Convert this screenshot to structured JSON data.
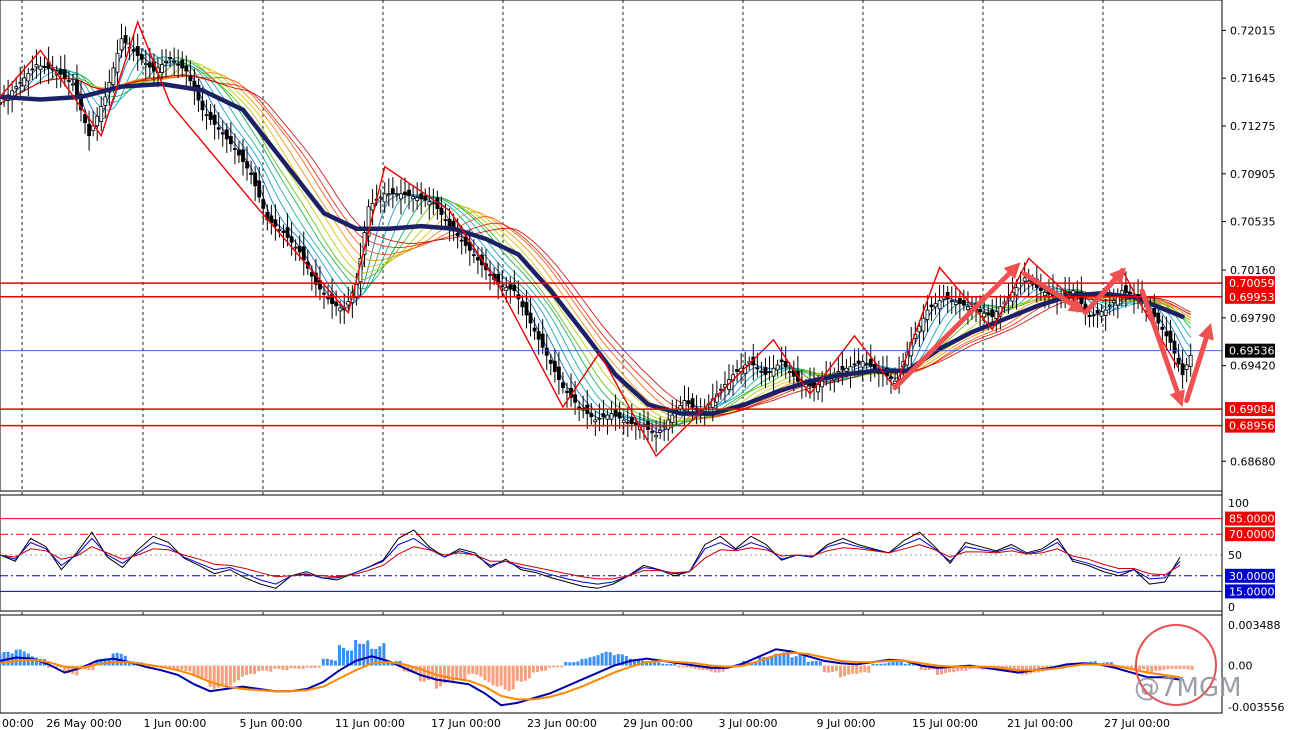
{
  "chart_data": [
    {
      "panel": "price",
      "type": "candlestick",
      "y_ticks": [
        "0.72015",
        "0.71645",
        "0.71275",
        "0.70905",
        "0.70535",
        "0.70160",
        "0.69790",
        "0.69420",
        "0.68680"
      ],
      "ylim": [
        0.6845,
        0.7225
      ],
      "x_tick_labels": [
        "00:00",
        "26 May 00:00",
        "1 Jun 00:00",
        "5 Jun 00:00",
        "11 Jun 00:00",
        "17 Jun 00:00",
        "23 Jun 00:00",
        "29 Jun 00:00",
        "3 Jul 00:00",
        "9 Jul 00:00",
        "15 Jul 00:00",
        "21 Jul 00:00",
        "27 Jul 00:00"
      ],
      "current_price": "0.69536",
      "horizontal_levels": [
        {
          "label": "0.70059",
          "value": 0.70059,
          "color": "#ee0000"
        },
        {
          "label": "0.69953",
          "value": 0.69953,
          "color": "#ee0000"
        },
        {
          "label": "0.69084",
          "value": 0.69084,
          "color": "#ee0000"
        },
        {
          "label": "0.68956",
          "value": 0.68956,
          "color": "#ee0000"
        },
        {
          "label": "0.69536",
          "value": 0.69536,
          "color": "#2255cc"
        }
      ],
      "close_path": [
        [
          0,
          0.7145
        ],
        [
          4,
          0.7158
        ],
        [
          9,
          0.7175
        ],
        [
          14,
          0.717
        ],
        [
          18,
          0.716
        ],
        [
          22,
          0.712
        ],
        [
          26,
          0.715
        ],
        [
          30,
          0.7195
        ],
        [
          34,
          0.7182
        ],
        [
          38,
          0.717
        ],
        [
          42,
          0.718
        ],
        [
          46,
          0.717
        ],
        [
          50,
          0.714
        ],
        [
          54,
          0.7125
        ],
        [
          58,
          0.711
        ],
        [
          62,
          0.709
        ],
        [
          66,
          0.7055
        ],
        [
          70,
          0.7045
        ],
        [
          74,
          0.703
        ],
        [
          78,
          0.7005
        ],
        [
          82,
          0.699
        ],
        [
          85,
          0.6985
        ],
        [
          88,
          0.7005
        ],
        [
          91,
          0.7065
        ],
        [
          95,
          0.7075
        ],
        [
          99,
          0.7075
        ],
        [
          103,
          0.7072
        ],
        [
          107,
          0.7068
        ],
        [
          111,
          0.705
        ],
        [
          115,
          0.7035
        ],
        [
          119,
          0.702
        ],
        [
          123,
          0.7005
        ],
        [
          127,
          0.7
        ],
        [
          131,
          0.6975
        ],
        [
          135,
          0.695
        ],
        [
          139,
          0.6925
        ],
        [
          143,
          0.691
        ],
        [
          147,
          0.69
        ],
        [
          151,
          0.6905
        ],
        [
          155,
          0.6898
        ],
        [
          159,
          0.6895
        ],
        [
          162,
          0.6888
        ],
        [
          165,
          0.69
        ],
        [
          169,
          0.6915
        ],
        [
          173,
          0.6905
        ],
        [
          177,
          0.692
        ],
        [
          181,
          0.6935
        ],
        [
          185,
          0.6945
        ],
        [
          189,
          0.6935
        ],
        [
          193,
          0.6945
        ],
        [
          197,
          0.693
        ],
        [
          201,
          0.6925
        ],
        [
          205,
          0.6935
        ],
        [
          209,
          0.694
        ],
        [
          213,
          0.6945
        ],
        [
          217,
          0.6938
        ],
        [
          221,
          0.693
        ],
        [
          225,
          0.696
        ],
        [
          229,
          0.6985
        ],
        [
          233,
          0.6995
        ],
        [
          237,
          0.699
        ],
        [
          241,
          0.6985
        ],
        [
          245,
          0.698
        ],
        [
          249,
          0.6995
        ],
        [
          253,
          0.701
        ],
        [
          257,
          0.7
        ],
        [
          261,
          0.6995
        ],
        [
          265,
          0.7
        ],
        [
          269,
          0.698
        ],
        [
          273,
          0.6985
        ],
        [
          277,
          0.7
        ],
        [
          281,
          0.6995
        ],
        [
          285,
          0.698
        ],
        [
          289,
          0.696
        ],
        [
          292,
          0.6935
        ],
        [
          294,
          0.695
        ]
      ],
      "moving_average": [
        [
          0,
          0.715
        ],
        [
          10,
          0.7148
        ],
        [
          20,
          0.715
        ],
        [
          30,
          0.7158
        ],
        [
          40,
          0.716
        ],
        [
          50,
          0.7155
        ],
        [
          60,
          0.714
        ],
        [
          70,
          0.71
        ],
        [
          80,
          0.706
        ],
        [
          88,
          0.7048
        ],
        [
          96,
          0.7048
        ],
        [
          104,
          0.705
        ],
        [
          112,
          0.7048
        ],
        [
          120,
          0.704
        ],
        [
          128,
          0.7028
        ],
        [
          136,
          0.7
        ],
        [
          144,
          0.6968
        ],
        [
          152,
          0.6935
        ],
        [
          160,
          0.6912
        ],
        [
          168,
          0.6905
        ],
        [
          176,
          0.6905
        ],
        [
          184,
          0.6912
        ],
        [
          192,
          0.6922
        ],
        [
          200,
          0.693
        ],
        [
          208,
          0.6935
        ],
        [
          216,
          0.6938
        ],
        [
          224,
          0.6938
        ],
        [
          232,
          0.6955
        ],
        [
          240,
          0.6968
        ],
        [
          248,
          0.6978
        ],
        [
          256,
          0.6988
        ],
        [
          264,
          0.6996
        ],
        [
          272,
          0.6998
        ],
        [
          280,
          0.6995
        ],
        [
          288,
          0.6985
        ],
        [
          292,
          0.698
        ]
      ],
      "zigzag": [
        [
          0,
          0.715
        ],
        [
          10,
          0.7186
        ],
        [
          25,
          0.712
        ],
        [
          34,
          0.7208
        ],
        [
          42,
          0.7145
        ],
        [
          62,
          0.707
        ],
        [
          86,
          0.6983
        ],
        [
          95,
          0.7096
        ],
        [
          111,
          0.7062
        ],
        [
          123,
          0.7005
        ],
        [
          139,
          0.691
        ],
        [
          148,
          0.6952
        ],
        [
          162,
          0.6872
        ],
        [
          191,
          0.6962
        ],
        [
          200,
          0.692
        ],
        [
          211,
          0.6965
        ],
        [
          221,
          0.6925
        ],
        [
          232,
          0.7018
        ],
        [
          245,
          0.697
        ],
        [
          254,
          0.7025
        ],
        [
          268,
          0.6985
        ],
        [
          277,
          0.7017
        ],
        [
          281,
          0.6993
        ],
        [
          291,
          0.694
        ]
      ],
      "arrows": [
        {
          "from": [
            221,
            0.6925
          ],
          "to": [
            252,
            0.7022
          ]
        },
        {
          "from": [
            253,
            0.7013
          ],
          "to": [
            268,
            0.6983
          ]
        },
        {
          "from": [
            268,
            0.6983
          ],
          "to": [
            278,
            0.7018
          ]
        },
        {
          "from": [
            282,
            0.7
          ],
          "to": [
            292,
            0.691
          ]
        },
        {
          "from": [
            293,
            0.6915
          ],
          "to": [
            299,
            0.6975
          ]
        }
      ]
    },
    {
      "panel": "stochastic",
      "type": "line",
      "levels": [
        {
          "label": "85.0000",
          "value": 85,
          "style": "solid",
          "color": "#ee0000"
        },
        {
          "label": "70.0000",
          "value": 70,
          "style": "dashdot",
          "color": "#ee0000"
        },
        {
          "label": "30.0000",
          "value": 30,
          "style": "dashdot",
          "color": "#0000cc"
        },
        {
          "label": "15.0000",
          "value": 15,
          "style": "solid",
          "color": "#0000cc"
        }
      ],
      "axis_labels": [
        "100",
        "50",
        "0"
      ],
      "ylim": [
        0,
        100
      ],
      "series": [
        {
          "color": "#000000",
          "values": [
            50,
            44,
            66,
            58,
            36,
            52,
            72,
            48,
            38,
            55,
            68,
            62,
            47,
            40,
            32,
            36,
            28,
            22,
            18,
            30,
            34,
            28,
            26,
            32,
            38,
            45,
            66,
            74,
            58,
            48,
            56,
            52,
            38,
            46,
            36,
            33,
            28,
            24,
            20,
            18,
            22,
            30,
            40,
            36,
            30,
            34,
            60,
            68,
            56,
            68,
            60,
            45,
            50,
            48,
            60,
            66,
            60,
            56,
            52,
            64,
            72,
            58,
            42,
            62,
            58,
            54,
            60,
            52,
            56,
            66,
            44,
            40,
            34,
            30,
            36,
            22,
            24,
            48
          ]
        },
        {
          "color": "#0000cc",
          "values": [
            50,
            46,
            62,
            56,
            40,
            50,
            66,
            50,
            42,
            52,
            62,
            58,
            48,
            42,
            36,
            38,
            32,
            26,
            22,
            30,
            32,
            28,
            28,
            32,
            38,
            44,
            60,
            66,
            56,
            48,
            54,
            50,
            40,
            44,
            38,
            35,
            31,
            27,
            24,
            22,
            24,
            30,
            38,
            36,
            32,
            34,
            56,
            62,
            55,
            62,
            57,
            46,
            50,
            48,
            58,
            62,
            58,
            55,
            52,
            60,
            66,
            56,
            44,
            58,
            55,
            53,
            57,
            51,
            54,
            62,
            46,
            42,
            37,
            33,
            36,
            27,
            28,
            44
          ]
        },
        {
          "color": "#cc0000",
          "values": [
            50,
            48,
            56,
            54,
            46,
            49,
            58,
            52,
            46,
            50,
            56,
            55,
            50,
            46,
            41,
            40,
            37,
            33,
            29,
            30,
            31,
            30,
            29,
            31,
            35,
            40,
            51,
            58,
            55,
            50,
            52,
            50,
            44,
            44,
            41,
            38,
            35,
            32,
            29,
            27,
            27,
            30,
            35,
            35,
            33,
            34,
            47,
            55,
            54,
            57,
            55,
            49,
            50,
            49,
            54,
            57,
            56,
            54,
            52,
            56,
            60,
            55,
            48,
            53,
            53,
            52,
            54,
            51,
            52,
            56,
            49,
            46,
            41,
            37,
            37,
            32,
            31,
            40
          ]
        }
      ]
    },
    {
      "panel": "macd",
      "type": "bar_line",
      "axis_labels": [
        "0.003488",
        "0.00",
        "-0.003556"
      ],
      "ylim": [
        -0.003556,
        0.003488
      ],
      "histogram": [
        0.0012,
        0.0014,
        0.0008,
        -0.0002,
        -0.0009,
        -0.0004,
        0.0006,
        0.0011,
        0.0004,
        -0.0002,
        -0.0003,
        -0.0005,
        -0.0012,
        -0.002,
        -0.0018,
        -0.001,
        -0.0006,
        -0.0004,
        -0.0003,
        -0.0002,
        0.0006,
        0.0018,
        0.0026,
        0.002,
        0.0004,
        -0.0006,
        -0.0014,
        -0.002,
        -0.0016,
        -0.001,
        -0.0018,
        -0.0022,
        -0.0014,
        -0.0006,
        -0.0002,
        0.0004,
        0.0008,
        0.0012,
        0.001,
        0.0006,
        0.0004,
        0.0002,
        -0.0002,
        -0.0004,
        -0.0006,
        -0.0002,
        0.0004,
        0.001,
        0.0014,
        0.001,
        0.0004,
        -0.0006,
        -0.001,
        -0.0008,
        0.0002,
        0.0004,
        0.0002,
        -0.0004,
        -0.0008,
        -0.0006,
        -0.0004,
        -0.0002,
        -0.0006,
        -0.0008,
        -0.0006,
        -0.0004,
        0.0002,
        0.0004,
        0.0003,
        -0.0002,
        -0.0004,
        -0.0006,
        -0.0004,
        -0.0004
      ],
      "series": [
        {
          "color": "#0000aa",
          "values": [
            0.0004,
            0.0007,
            0.0006,
            0.0001,
            -0.0006,
            -0.0002,
            0.0004,
            0.0006,
            0.0003,
            -0.0001,
            -0.0004,
            -0.0008,
            -0.0016,
            -0.0022,
            -0.002,
            -0.0018,
            -0.002,
            -0.0022,
            -0.0022,
            -0.002,
            -0.0014,
            -0.0004,
            0.0004,
            0.0008,
            0.0004,
            -0.0002,
            -0.0008,
            -0.0012,
            -0.0014,
            -0.0016,
            -0.0024,
            -0.0034,
            -0.0032,
            -0.0028,
            -0.0024,
            -0.0018,
            -0.0012,
            -0.0006,
            0.0,
            0.0004,
            0.0006,
            0.0004,
            0.0002,
            0.0,
            -0.0002,
            -0.0002,
            0.0002,
            0.0008,
            0.0014,
            0.0012,
            0.0008,
            0.0004,
            0.0002,
            0.0001,
            0.0003,
            0.0005,
            0.0004,
            0.0,
            -0.0002,
            -0.0001,
            0.0,
            -0.0002,
            -0.0004,
            -0.0006,
            -0.0004,
            -0.0002,
            0.0001,
            0.0002,
            0.0001,
            -0.0002,
            -0.0006,
            -0.001,
            -0.001,
            -0.0012
          ]
        },
        {
          "color": "#ff8800",
          "values": [
            0.0002,
            0.0004,
            0.0005,
            0.0003,
            -0.0001,
            -0.0002,
            0.0001,
            0.0003,
            0.0003,
            0.0001,
            -0.0001,
            -0.0004,
            -0.0008,
            -0.0014,
            -0.0018,
            -0.002,
            -0.0021,
            -0.0022,
            -0.0022,
            -0.0021,
            -0.0018,
            -0.0011,
            -0.0004,
            0.0002,
            0.0003,
            0.0001,
            -0.0003,
            -0.0008,
            -0.0011,
            -0.0013,
            -0.0018,
            -0.0026,
            -0.0029,
            -0.0029,
            -0.0027,
            -0.0023,
            -0.0018,
            -0.0012,
            -0.0006,
            -0.0001,
            0.0003,
            0.0004,
            0.0003,
            0.0002,
            0.0,
            -0.0001,
            0.0,
            0.0004,
            0.0009,
            0.0011,
            0.001,
            0.0007,
            0.0004,
            0.0003,
            0.0003,
            0.0004,
            0.0004,
            0.0002,
            0.0,
            -0.0001,
            -0.0001,
            -0.0001,
            -0.0002,
            -0.0004,
            -0.0004,
            -0.0003,
            -0.0001,
            0.0001,
            0.0001,
            0.0,
            -0.0003,
            -0.0006,
            -0.0008,
            -0.001
          ]
        }
      ]
    }
  ],
  "watermark": "@7MGM"
}
